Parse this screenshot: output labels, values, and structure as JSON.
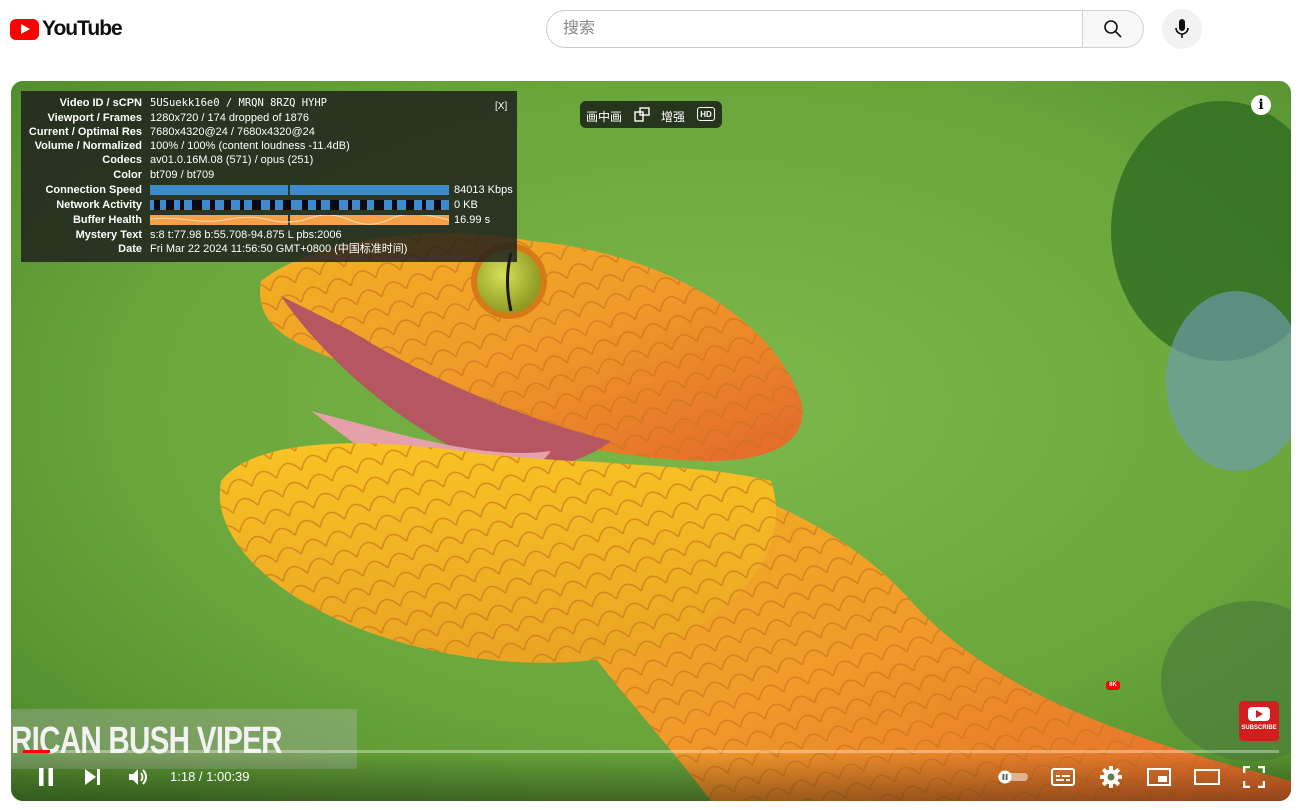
{
  "masthead": {
    "logo_text": "YouTube",
    "search_placeholder": "搜索"
  },
  "overlay_pill": {
    "pip_label": "画中画",
    "enhance_label": "增强",
    "hd_label": "HD"
  },
  "stats": {
    "close_label": "[X]",
    "rows": [
      {
        "label": "Video ID / sCPN",
        "value": "5USuekk16e0 / MRQN 8RZQ HYHP"
      },
      {
        "label": "Viewport / Frames",
        "value": "1280x720 / 174 dropped of 1876"
      },
      {
        "label": "Current / Optimal Res",
        "value": "7680x4320@24 / 7680x4320@24"
      },
      {
        "label": "Volume / Normalized",
        "value": "100% / 100% (content loudness -11.4dB)"
      },
      {
        "label": "Codecs",
        "value": "av01.0.16M.08 (571) / opus (251)"
      },
      {
        "label": "Color",
        "value": "bt709 / bt709"
      },
      {
        "label": "Connection Speed",
        "value": "84013 Kbps"
      },
      {
        "label": "Network Activity",
        "value": "0 KB"
      },
      {
        "label": "Buffer Health",
        "value": "16.99 s"
      },
      {
        "label": "Mystery Text",
        "value": "s:8 t:77.98 b:55.708-94.875 L pbs:2006"
      },
      {
        "label": "Date",
        "value": "Fri Mar 22 2024 11:56:50 GMT+0800 (中国标准时间)"
      }
    ]
  },
  "video": {
    "lower_third_title": "RICAN BUSH VIPER",
    "subscribe_label": "SUBSCRIBE"
  },
  "controls": {
    "current_time": "1:18",
    "duration": "1:00:39",
    "time_display": "1:18 / 1:00:39",
    "quality_badge": "8K",
    "progress_fraction": 0.0214
  },
  "colors": {
    "accent": "#ff0000",
    "stats_bar_blue": "#3d8bcd",
    "stats_bar_orange": "#f4a14a"
  }
}
